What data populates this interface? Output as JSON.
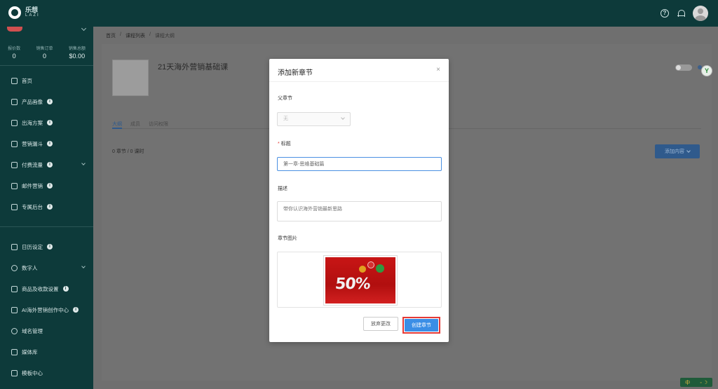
{
  "app": {
    "logo_text": "乐想",
    "logo_sub": "LAZI"
  },
  "sidebar": {
    "stats": [
      {
        "label": "报价数",
        "value": "0"
      },
      {
        "label": "销售订单",
        "value": "0"
      },
      {
        "label": "销售总额",
        "value": "$0.00"
      }
    ],
    "items_top": [
      {
        "label": "首页",
        "info": false,
        "caret": false
      },
      {
        "label": "产品画像",
        "info": true,
        "caret": false
      },
      {
        "label": "出海方案",
        "info": true,
        "caret": false
      },
      {
        "label": "营销漏斗",
        "info": true,
        "caret": false
      },
      {
        "label": "付费流量",
        "info": true,
        "caret": true
      },
      {
        "label": "邮件营销",
        "info": true,
        "caret": false
      },
      {
        "label": "专属后台",
        "info": true,
        "caret": false
      }
    ],
    "items_bottom": [
      {
        "label": "日历设定",
        "info": true,
        "caret": false
      },
      {
        "label": "数字人",
        "info": false,
        "caret": true
      },
      {
        "label": "商品及收款设置",
        "info": true,
        "caret": false
      },
      {
        "label": "AI海外营销创作中心",
        "info": true,
        "caret": false
      },
      {
        "label": "域名管理",
        "info": false,
        "caret": false
      },
      {
        "label": "媒体库",
        "info": false,
        "caret": false
      },
      {
        "label": "模板中心",
        "info": false,
        "caret": false
      }
    ]
  },
  "breadcrumb": {
    "home": "首页",
    "list": "课程列表",
    "current": "课程大纲",
    "sep": "/"
  },
  "course": {
    "title": "21天海外营销基础课"
  },
  "tabs": [
    "大纲",
    "成员",
    "访问权限"
  ],
  "summary": {
    "counts": "0 章节 / 0 课时",
    "add_button": "添加内容"
  },
  "modal": {
    "title": "添加新章节",
    "close": "×",
    "parent_label": "父章节",
    "parent_value": "无",
    "title_label": "标题",
    "title_value": "第一章-思维基础篇",
    "desc_label": "描述",
    "desc_value": "带你认识海外营销最新思路",
    "image_label": "章节图片",
    "image_text": "50%",
    "discard_button": "放弃更改",
    "create_button": "创建章节"
  },
  "ime": {
    "text": "中"
  },
  "colors": {
    "sidebar": "#0d3a3a",
    "primary": "#3a8ee6",
    "highlight": "#e53935"
  }
}
